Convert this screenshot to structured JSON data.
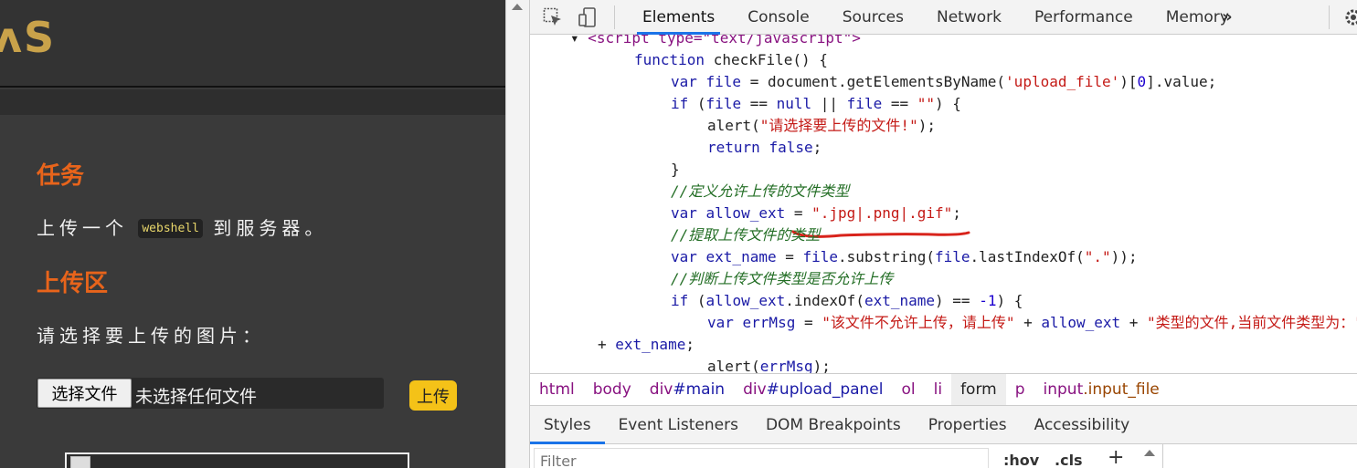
{
  "page": {
    "logo": "ᴧS",
    "task_heading": "任务",
    "task_text_before": "上传一个",
    "task_code": "webshell",
    "task_text_after": "到服务器。",
    "upload_heading": "上传区",
    "choose_prompt": "请选择要上传的图片：",
    "choose_button": "选择文件",
    "no_file": "未选择任何文件",
    "upload_button": "上传"
  },
  "devtools": {
    "tabs": [
      "Elements",
      "Console",
      "Sources",
      "Network",
      "Performance",
      "Memory"
    ],
    "more": "»",
    "code_lines": [
      [
        {
          "t": "▾ ",
          "c": "p"
        },
        {
          "t": "<script type=\"text/javascript\">",
          "c": "tag"
        }
      ],
      [
        {
          "t": "function ",
          "c": "kw"
        },
        {
          "t": "checkFile() {",
          "c": "p"
        }
      ],
      [
        {
          "t": "var ",
          "c": "kw"
        },
        {
          "t": "file",
          "c": "kw"
        },
        {
          "t": " = document.getElementsByName(",
          "c": "p"
        },
        {
          "t": "'upload_file'",
          "c": "str"
        },
        {
          "t": ")[",
          "c": "p"
        },
        {
          "t": "0",
          "c": "num"
        },
        {
          "t": "].value;",
          "c": "p"
        }
      ],
      [
        {
          "t": "if ",
          "c": "kw"
        },
        {
          "t": "(",
          "c": "p"
        },
        {
          "t": "file",
          "c": "kw"
        },
        {
          "t": " == ",
          "c": "p"
        },
        {
          "t": "null",
          "c": "kw"
        },
        {
          "t": " || ",
          "c": "p"
        },
        {
          "t": "file",
          "c": "kw"
        },
        {
          "t": " == ",
          "c": "p"
        },
        {
          "t": "\"\"",
          "c": "str"
        },
        {
          "t": ") {",
          "c": "p"
        }
      ],
      [
        {
          "t": "alert(",
          "c": "p"
        },
        {
          "t": "\"请选择要上传的文件!\"",
          "c": "str"
        },
        {
          "t": ");",
          "c": "p"
        }
      ],
      [
        {
          "t": "return ",
          "c": "kw"
        },
        {
          "t": "false",
          "c": "kw"
        },
        {
          "t": ";",
          "c": "p"
        }
      ],
      [
        {
          "t": "}",
          "c": "p"
        }
      ],
      [
        {
          "t": "//定义允许上传的文件类型",
          "c": "cm"
        }
      ],
      [
        {
          "t": "var ",
          "c": "kw"
        },
        {
          "t": "allow_ext",
          "c": "kw"
        },
        {
          "t": " = ",
          "c": "p"
        },
        {
          "t": "\".jpg|.png|.gif\"",
          "c": "str"
        },
        {
          "t": ";",
          "c": "p"
        }
      ],
      [
        {
          "t": "//提取上传文件的类型",
          "c": "cm"
        }
      ],
      [
        {
          "t": "var ",
          "c": "kw"
        },
        {
          "t": "ext_name",
          "c": "kw"
        },
        {
          "t": " = ",
          "c": "p"
        },
        {
          "t": "file",
          "c": "kw"
        },
        {
          "t": ".substring(",
          "c": "p"
        },
        {
          "t": "file",
          "c": "kw"
        },
        {
          "t": ".lastIndexOf(",
          "c": "p"
        },
        {
          "t": "\".\"",
          "c": "str"
        },
        {
          "t": "));",
          "c": "p"
        }
      ],
      [
        {
          "t": "//判断上传文件类型是否允许上传",
          "c": "cm"
        }
      ],
      [
        {
          "t": "if ",
          "c": "kw"
        },
        {
          "t": "(",
          "c": "p"
        },
        {
          "t": "allow_ext",
          "c": "kw"
        },
        {
          "t": ".indexOf(",
          "c": "p"
        },
        {
          "t": "ext_name",
          "c": "kw"
        },
        {
          "t": ") == ",
          "c": "p"
        },
        {
          "t": "-1",
          "c": "num"
        },
        {
          "t": ") {",
          "c": "p"
        }
      ],
      [
        {
          "t": "var ",
          "c": "kw"
        },
        {
          "t": "errMsg",
          "c": "kw"
        },
        {
          "t": " = ",
          "c": "p"
        },
        {
          "t": "\"该文件不允许上传，请上传\"",
          "c": "str"
        },
        {
          "t": " + ",
          "c": "p"
        },
        {
          "t": "allow_ext",
          "c": "kw"
        },
        {
          "t": " + ",
          "c": "p"
        },
        {
          "t": "\"类型的文件,当前文件类型为：\"",
          "c": "str"
        }
      ],
      [
        {
          "t": "+ ",
          "c": "p"
        },
        {
          "t": "ext_name",
          "c": "kw"
        },
        {
          "t": ";",
          "c": "p"
        }
      ],
      [
        {
          "t": "alert(",
          "c": "p"
        },
        {
          "t": "errMsg",
          "c": "kw"
        },
        {
          "t": ");",
          "c": "p"
        }
      ]
    ],
    "breadcrumbs": [
      "html",
      "body",
      "div#main",
      "div#upload_panel",
      "ol",
      "li",
      "form",
      "p",
      "input.input_file"
    ],
    "selected_crumb": "form",
    "subtabs": [
      "Styles",
      "Event Listeners",
      "DOM Breakpoints",
      "Properties",
      "Accessibility"
    ],
    "filter_placeholder": "Filter",
    "hov": ":hov",
    "cls": ".cls",
    "plus": "+"
  },
  "colors": {
    "keyword": "#1a1aa6",
    "string": "#c41a16",
    "comment": "#236e25",
    "accent_orange": "#e8641b",
    "upload_yellow": "#f4c218",
    "annotation_red": "#d8231b"
  }
}
